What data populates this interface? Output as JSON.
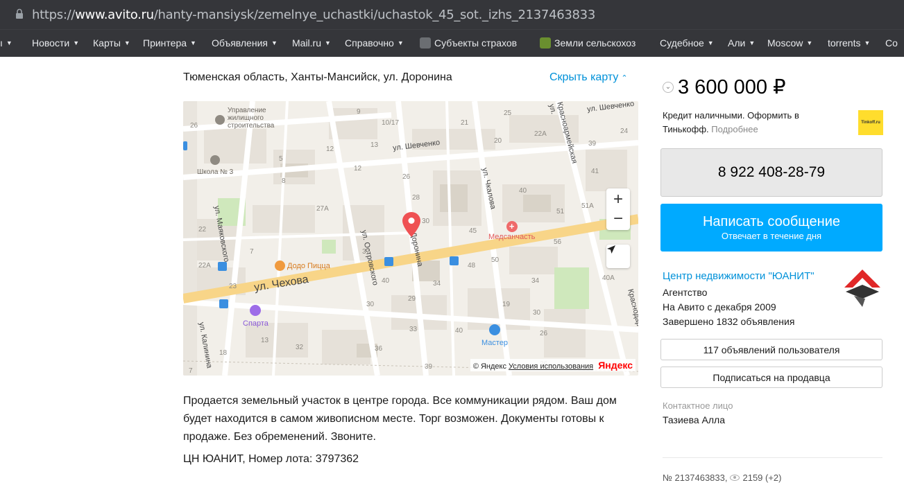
{
  "browser": {
    "url_prefix": "https://",
    "url_domain": "www.avito.ru",
    "url_path": "/hanty-mansiysk/zemelnye_uchastki/uchastok_45_sot._izhs_2137463833",
    "bookmarks": [
      {
        "label": "Новости",
        "caret": "▼"
      },
      {
        "label": "Карты",
        "caret": "▼"
      },
      {
        "label": "Принтера",
        "caret": "▼"
      },
      {
        "label": "Объявления",
        "caret": "▼"
      },
      {
        "label": "Mail.ru",
        "caret": "▼"
      },
      {
        "label": "Справочно",
        "caret": "▼"
      },
      {
        "label": "Субъекты страхов",
        "caret": ""
      },
      {
        "label": "Земли сельскохоз",
        "caret": ""
      },
      {
        "label": "Судебное",
        "caret": "▼"
      },
      {
        "label": "Али",
        "caret": "▼"
      },
      {
        "label": "Moscow",
        "caret": "▼"
      },
      {
        "label": "torrents",
        "caret": "▼"
      },
      {
        "label": "Co",
        "caret": ""
      }
    ],
    "bookmark_left_caret": "▼"
  },
  "listing": {
    "address": "Тюменская область, Ханты-Мансийск, ул. Доронина",
    "hide_map": "Скрыть карту",
    "description": "Продается земельный участок в центре города. Все коммуникации рядом. Ваш дом будет находится в самом живописном месте. Торг возможен. Документы готовы к продаже. Без обременений. Звоните.",
    "lot": "ЦН ЮАНИТ, Номер лота: 3797362"
  },
  "map": {
    "streets": {
      "chekhova": "ул. Чехова",
      "shevchenko_1": "ул. Шевченко",
      "shevchenko_2": "ул. Шевченко",
      "mayakovskogo": "ул. Маяковского",
      "ostrovskogo": "ул. Островского",
      "doronina": "Доронина",
      "chkalova": "ул. Чкалова",
      "krasnoarmeyskaya": "Красноармейская ул.",
      "krasnodar": "Краснодар",
      "kalinina": "ул. Калинина"
    },
    "pois": {
      "upravlenie": [
        "Управление",
        "жилищного",
        "строительства"
      ],
      "school": "Школа № 3",
      "dodo": "Додо Пицца",
      "sparta": "Спарта",
      "medsanchast": "Медсанчасть",
      "master": "Мастер"
    },
    "house_numbers": [
      "26",
      "9",
      "25",
      "10/17",
      "21",
      "22A",
      "24",
      "13",
      "12",
      "20",
      "39",
      "5",
      "12",
      "8",
      "26",
      "41",
      "27A",
      "28",
      "40",
      "51",
      "51A",
      "22",
      "30",
      "45",
      "56",
      "37",
      "50",
      "48",
      "22A",
      "7",
      "40",
      "34",
      "34",
      "40A",
      "23",
      "30",
      "29",
      "19",
      "30",
      "36",
      "33",
      "40",
      "13",
      "32",
      "18",
      "39",
      "26",
      "26",
      "7"
    ],
    "zoom_in": "+",
    "zoom_out": "−",
    "copyright": "© Яндекс",
    "terms": "Условия использования",
    "yandex": "Яндекс"
  },
  "sidebar": {
    "price": "3 600 000 ₽",
    "price_icon": "⌄",
    "credit_text": "Кредит наличными. Оформить в Тинькофф.",
    "credit_more": "Подробнее",
    "tinkoff_label": "Tinkoff.ru",
    "phone": "8 922 408-28-79",
    "message_button": "Написать сообщение",
    "message_sub": "Отвечает в течение дня",
    "seller_name": "Центр недвижимости \"ЮАНИТ\"",
    "seller_type": "Агентство",
    "seller_since": "На Авито с декабря 2009",
    "seller_done": "Завершено 1832 объявления",
    "listings_button": "117 объявлений пользователя",
    "subscribe_button": "Подписаться на продавца",
    "contact_label": "Контактное лицо",
    "contact_name": "Тазиева Алла",
    "ad_number": "№ 2137463833,",
    "views": "2159 (+2)"
  },
  "colors": {
    "link": "#0091d9",
    "primary_button": "#00aaff",
    "marker": "#ef5153",
    "main_road": "#f8d588"
  }
}
